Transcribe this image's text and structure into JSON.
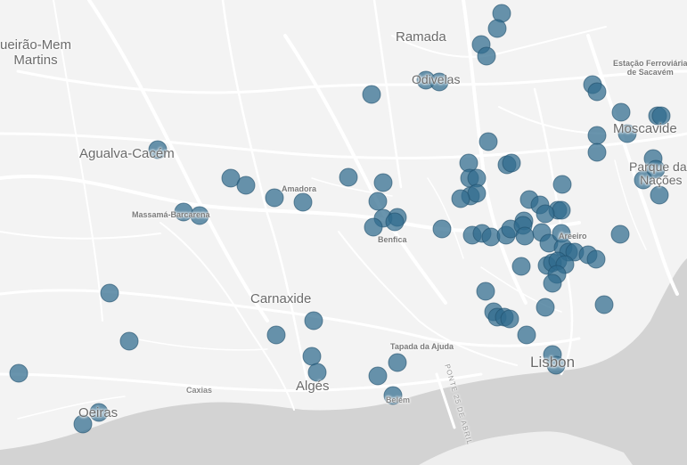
{
  "map": {
    "colors": {
      "land": "#f3f3f3",
      "water": "#d4d4d4",
      "roads": "#ffffff",
      "marker": "#2f6b8e"
    },
    "labels": {
      "queluz_mem_martins": "ueirão-Mem\nMartins",
      "ramada": "Ramada",
      "odivelas": "Odivelas",
      "sacavem": "Estação Ferroviária\nde Sacavém",
      "moscavide": "Moscavide",
      "agualva_cacem": "Agualva-Cacém",
      "amadora": "Amadora",
      "massama_barcarena": "Massamá-Barcarena",
      "parque_nacoes": "Parque das\nNações",
      "benfica": "Benfica",
      "areeiro": "Areeiro",
      "carnaxide": "Carnaxide",
      "tapada_ajuda": "Tapada da Ajuda",
      "lisbon": "Lisbon",
      "alges": "Algés",
      "caxias": "Caxias",
      "belem": "Belém",
      "ponte": "PONTE 25 DE ABRIL",
      "oeiras": "Oeiras"
    }
  }
}
